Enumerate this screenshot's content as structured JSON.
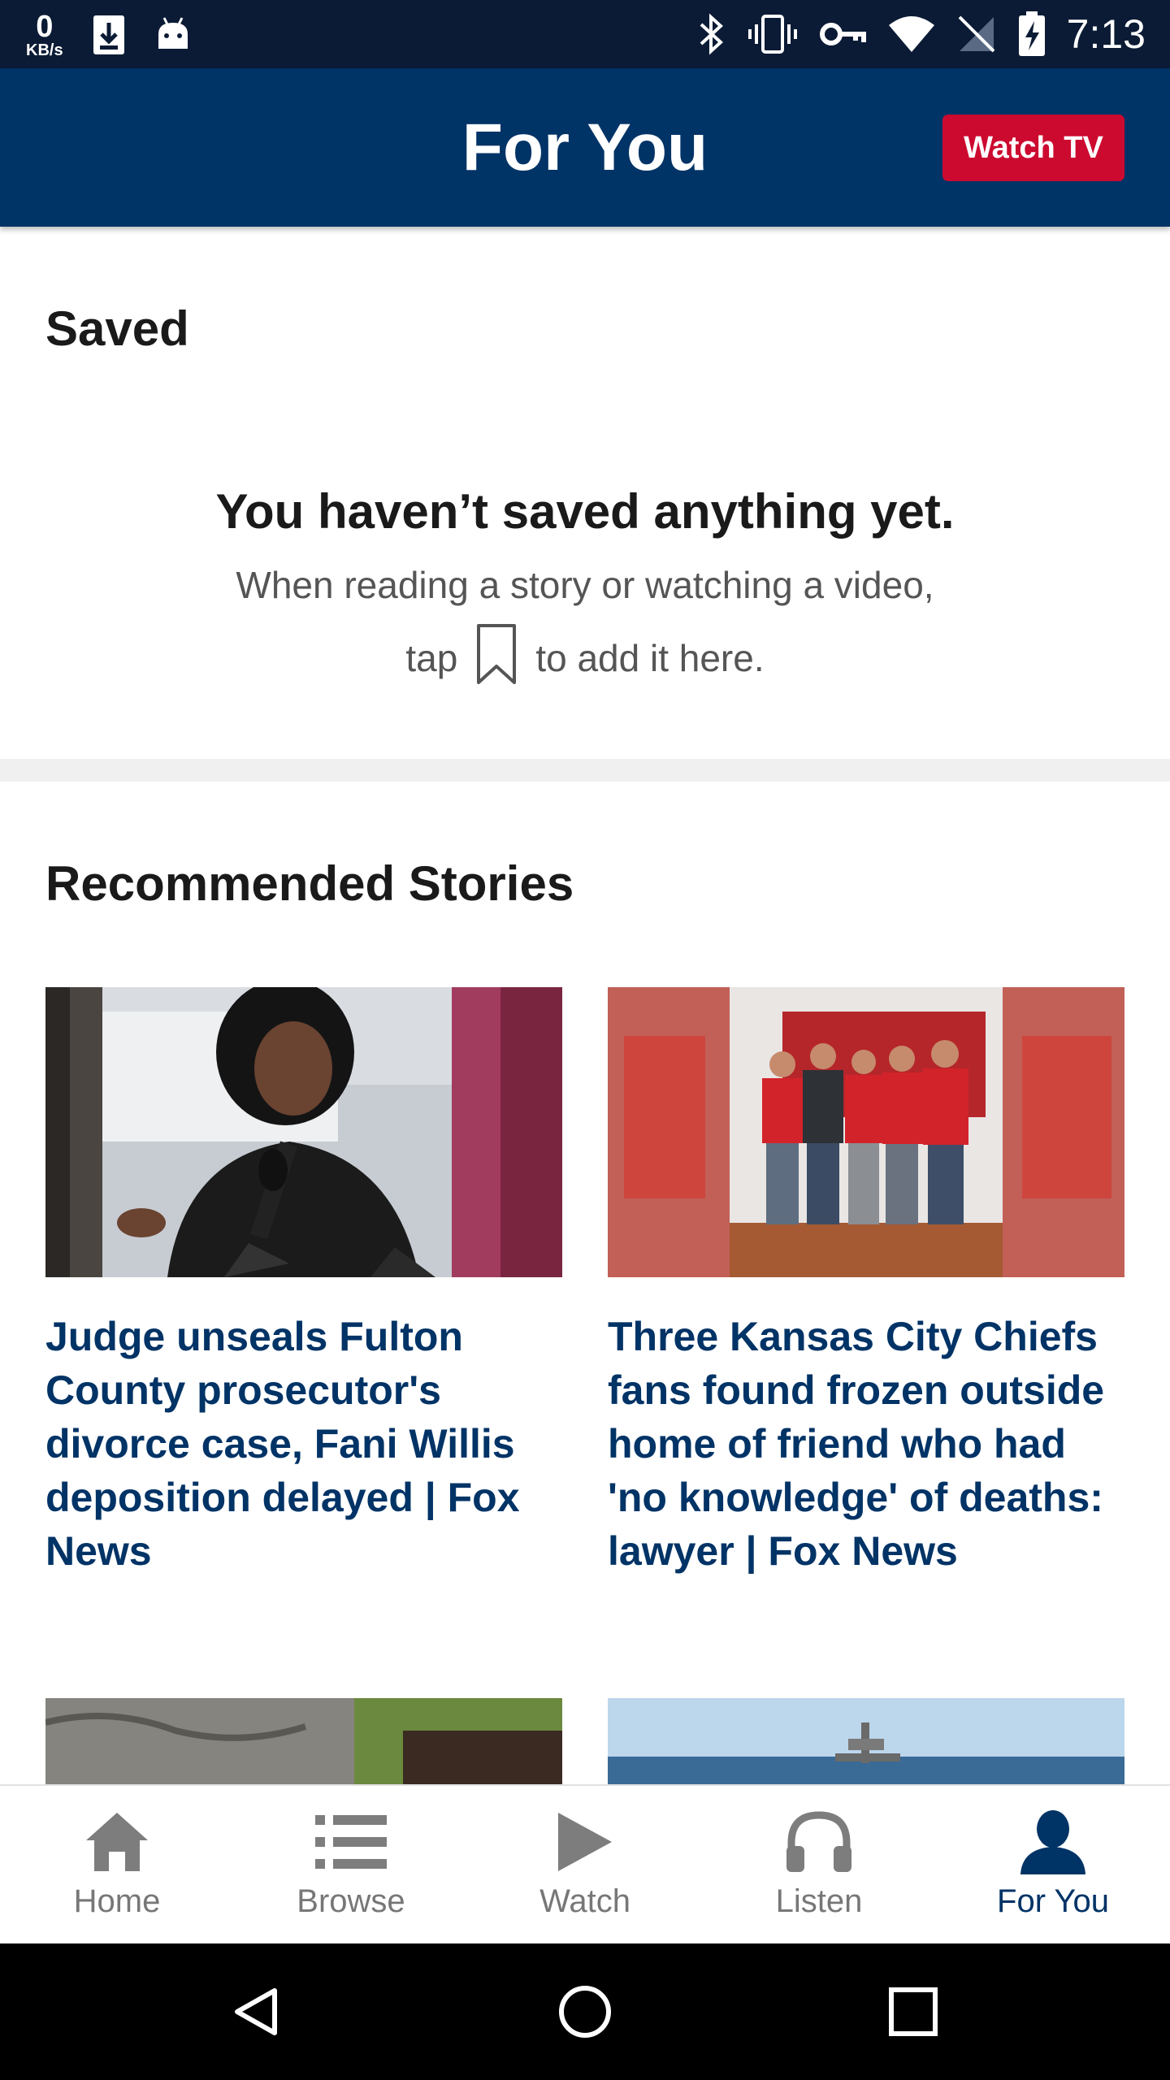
{
  "status_bar": {
    "net_speed_value": "0",
    "net_speed_unit": "KB/s",
    "time": "7:13",
    "icons": [
      "download-icon",
      "android-icon",
      "bluetooth-icon",
      "vibrate-icon",
      "vpn-key-icon",
      "wifi-icon",
      "no-sim-icon",
      "battery-charging-icon"
    ]
  },
  "app_bar": {
    "title": "For You",
    "watch_tv_label": "Watch TV"
  },
  "saved": {
    "title": "Saved",
    "empty_heading": "You haven’t saved anything yet.",
    "empty_line1": "When reading a story or watching a video,",
    "empty_line2_prefix": "tap",
    "empty_line2_suffix": "to add it here.",
    "icon": "bookmark-icon"
  },
  "recommended": {
    "title": "Recommended Stories",
    "stories": [
      {
        "title": "Judge unseals Fulton County prosecutor's divorce case, Fani Willis deposition delayed | Fox News",
        "image": "woman-speaking-at-podium-photo"
      },
      {
        "title": "Three Kansas City Chiefs fans found frozen outside home of friend who had 'no knowledge' of deaths: lawyer | Fox News",
        "image": "five-men-in-chiefs-jerseys-photo"
      },
      {
        "title": "",
        "image": "border-fence-photo"
      },
      {
        "title": "",
        "image": "navy-ship-at-sea-photo"
      }
    ]
  },
  "bottom_nav": {
    "items": [
      {
        "label": "Home",
        "icon": "home-icon",
        "active": false
      },
      {
        "label": "Browse",
        "icon": "list-icon",
        "active": false
      },
      {
        "label": "Watch",
        "icon": "play-icon",
        "active": false
      },
      {
        "label": "Listen",
        "icon": "headphones-icon",
        "active": false
      },
      {
        "label": "For You",
        "icon": "person-icon",
        "active": true
      }
    ]
  },
  "colors": {
    "brand_navy": "#003366",
    "status_bar": "#0b1b35",
    "accent_red": "#cc0a2f",
    "inactive_gray": "#777777"
  }
}
